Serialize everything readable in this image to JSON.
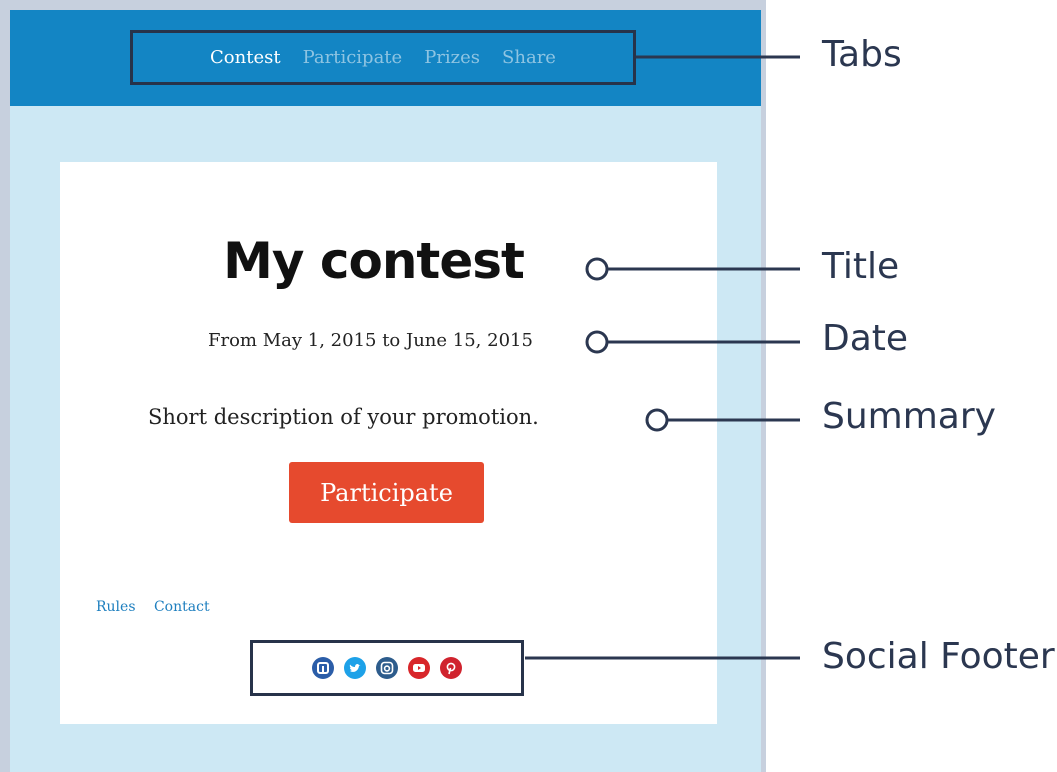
{
  "tabs": [
    "Contest",
    "Participate",
    "Prizes",
    "Share"
  ],
  "title": "My contest",
  "date": "From May 1, 2015 to June 15, 2015",
  "summary": "Short description of your promotion.",
  "cta": "Participate",
  "footer_links": [
    "Rules",
    "Contact"
  ],
  "social_icons": [
    "facebook-icon",
    "twitter-icon",
    "instagram-icon",
    "youtube-icon",
    "pinterest-icon"
  ],
  "callouts": {
    "tabs": "Tabs",
    "title": "Title",
    "date": "Date",
    "summary": "Summary",
    "social": "Social Footer"
  },
  "colors": {
    "topbar": "#1385c4",
    "page_bg": "#cde8f4",
    "cta": "#e64a2e",
    "annotation": "#2b3750"
  }
}
